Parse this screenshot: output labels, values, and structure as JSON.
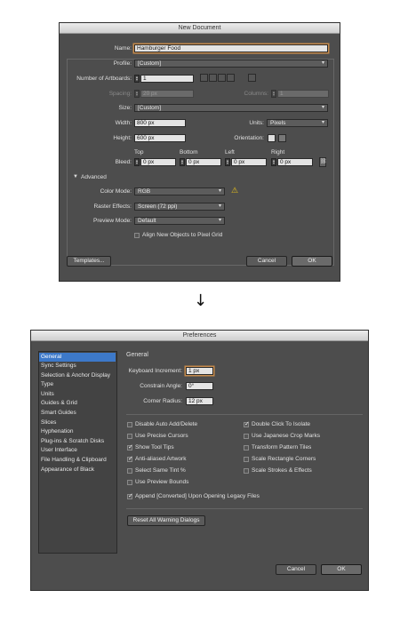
{
  "new_doc": {
    "title": "New Document",
    "name_label": "Name:",
    "name_value": "Hamburger Food",
    "profile_label": "Profile:",
    "profile_value": "[Custom]",
    "artboards_label": "Number of Artboards:",
    "artboards_value": "1",
    "spacing_label": "Spacing:",
    "spacing_value": "20 px",
    "columns_label": "Columns:",
    "columns_value": "1",
    "size_label": "Size:",
    "size_value": "[Custom]",
    "width_label": "Width:",
    "width_value": "800 px",
    "units_label": "Units:",
    "units_value": "Pixels",
    "height_label": "Height:",
    "height_value": "600 px",
    "orientation_label": "Orientation:",
    "bleed_label": "Bleed:",
    "bleed_top_label": "Top",
    "bleed_bottom_label": "Bottom",
    "bleed_left_label": "Left",
    "bleed_right_label": "Right",
    "bleed_top": "0 px",
    "bleed_bottom": "0 px",
    "bleed_left": "0 px",
    "bleed_right": "0 px",
    "advanced_label": "Advanced",
    "color_mode_label": "Color Mode:",
    "color_mode_value": "RGB",
    "raster_label": "Raster Effects:",
    "raster_value": "Screen (72 ppi)",
    "preview_label": "Preview Mode:",
    "preview_value": "Default",
    "align_label": "Align New Objects to Pixel Grid",
    "templates_button": "Templates...",
    "cancel_button": "Cancel",
    "ok_button": "OK"
  },
  "arrow": "↓",
  "prefs": {
    "title": "Preferences",
    "sidebar": [
      "General",
      "Sync Settings",
      "Selection & Anchor Display",
      "Type",
      "Units",
      "Guides & Grid",
      "Smart Guides",
      "Slices",
      "Hyphenation",
      "Plug-ins & Scratch Disks",
      "User Interface",
      "File Handling & Clipboard",
      "Appearance of Black"
    ],
    "section_title": "General",
    "keyboard_label": "Keyboard Increment:",
    "keyboard_value": "1 px",
    "constrain_label": "Constrain Angle:",
    "constrain_value": "0°",
    "corner_label": "Corner Radius:",
    "corner_value": "12 px",
    "options_left": [
      {
        "label": "Disable Auto Add/Delete",
        "checked": false
      },
      {
        "label": "Use Precise Cursors",
        "checked": false
      },
      {
        "label": "Show Tool Tips",
        "checked": true
      },
      {
        "label": "Anti-aliased Artwork",
        "checked": true
      },
      {
        "label": "Select Same Tint %",
        "checked": false
      },
      {
        "label": "Use Preview Bounds",
        "checked": false
      }
    ],
    "options_right": [
      {
        "label": "Double Click To Isolate",
        "checked": true
      },
      {
        "label": "Use Japanese Crop Marks",
        "checked": false
      },
      {
        "label": "Transform Pattern Tiles",
        "checked": false
      },
      {
        "label": "Scale Rectangle Corners",
        "checked": false
      },
      {
        "label": "Scale Strokes & Effects",
        "checked": false
      }
    ],
    "append_label": "Append [Converted] Upon Opening Legacy Files",
    "append_checked": true,
    "reset_button": "Reset All Warning Dialogs",
    "cancel_button": "Cancel",
    "ok_button": "OK"
  }
}
